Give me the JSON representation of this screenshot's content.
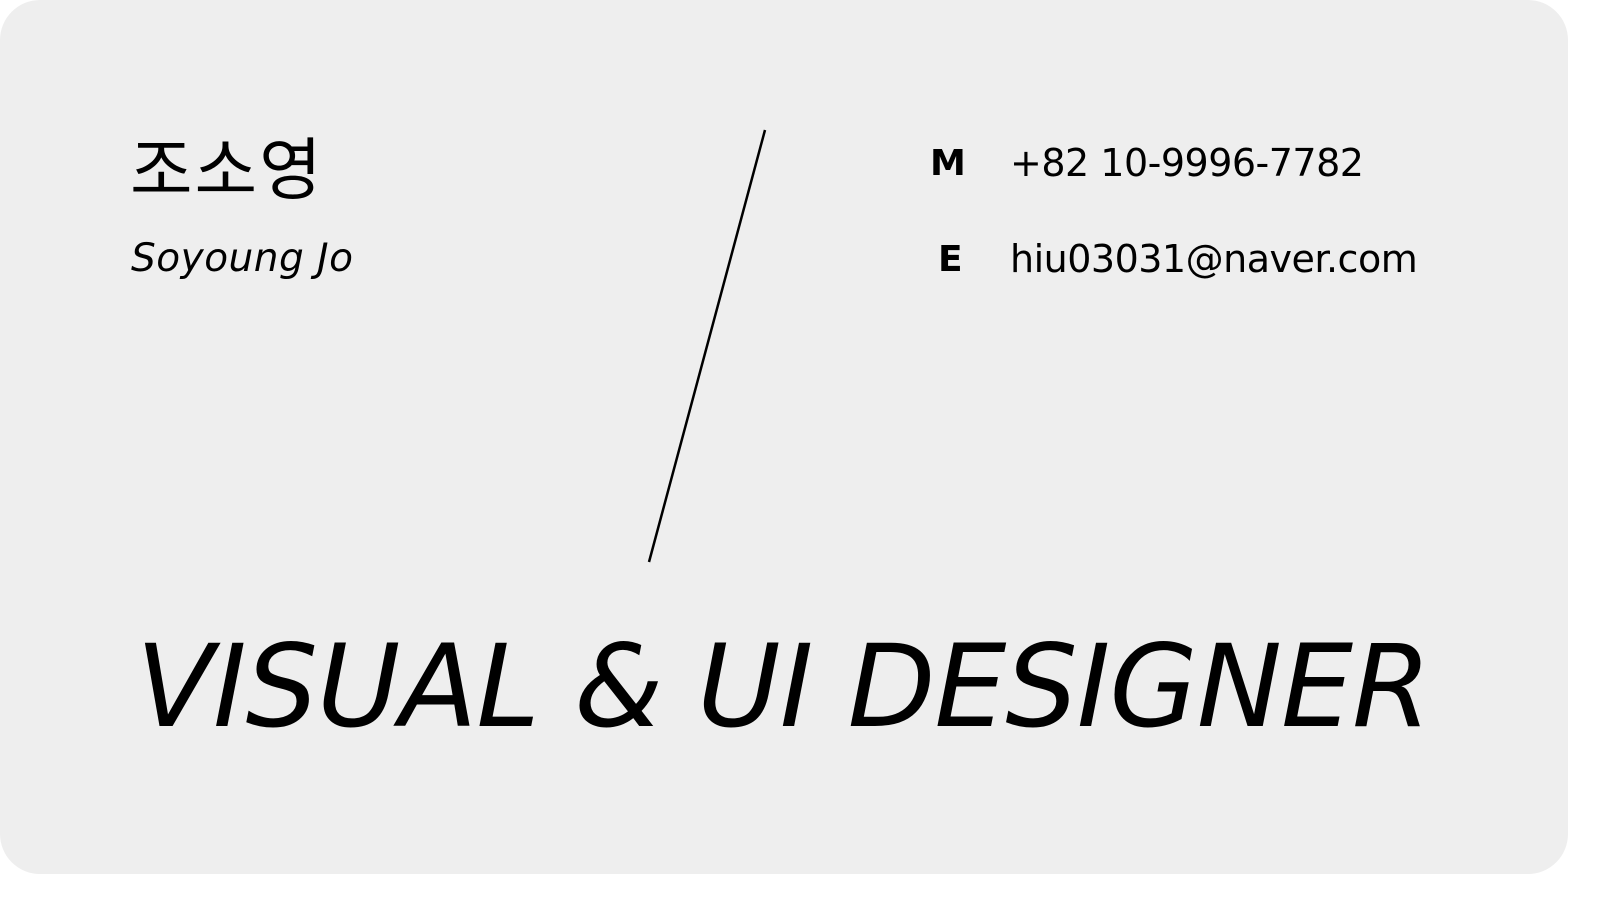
{
  "card": {
    "name_korean": "조소영",
    "name_english": "Soyoung Jo",
    "contacts": [
      {
        "label": "M",
        "value": "+82 10-9996-7782"
      },
      {
        "label": "E",
        "value": "hiu03031@naver.com"
      }
    ],
    "title": "VISUAL & UI DESIGNER",
    "colors": {
      "background": "#eeeeee",
      "text": "#000000"
    }
  }
}
